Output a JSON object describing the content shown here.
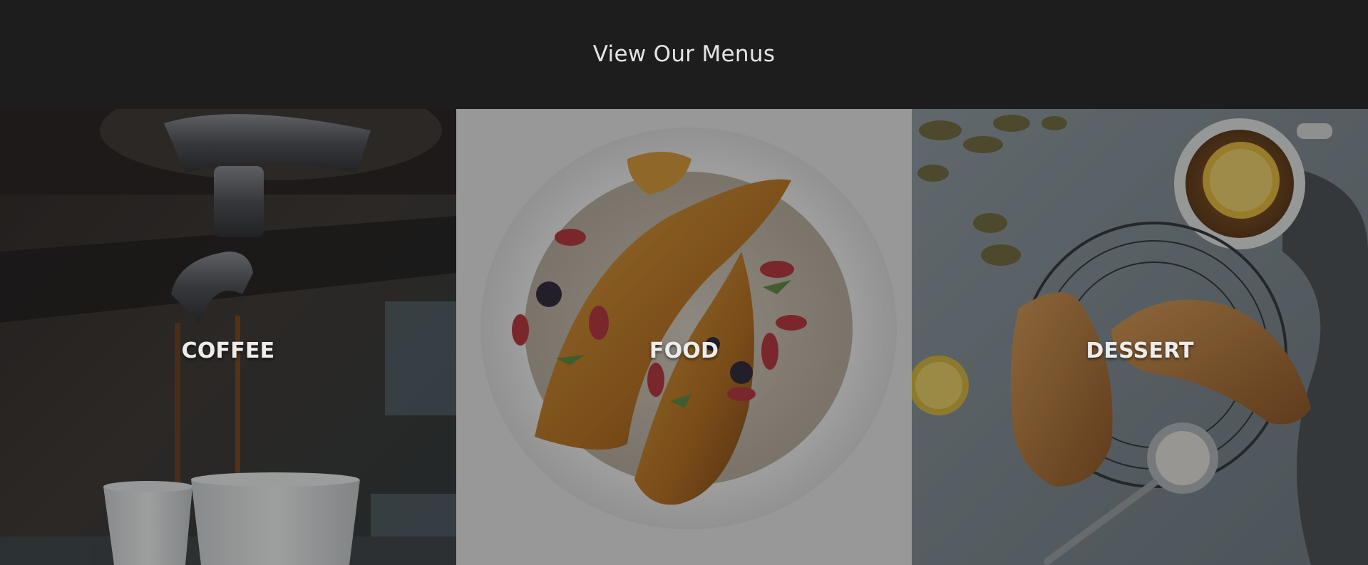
{
  "section": {
    "title": "View Our Menus"
  },
  "menus": [
    {
      "label": "COFFEE",
      "icon": "espresso-machine-photo"
    },
    {
      "label": "FOOD",
      "icon": "porridge-bowl-photo"
    },
    {
      "label": "DESSERT",
      "icon": "croissant-lemon-tea-photo"
    }
  ],
  "colors": {
    "background": "#1d1d1d",
    "title_text": "#e4e4e4",
    "label_text": "#ececec"
  }
}
